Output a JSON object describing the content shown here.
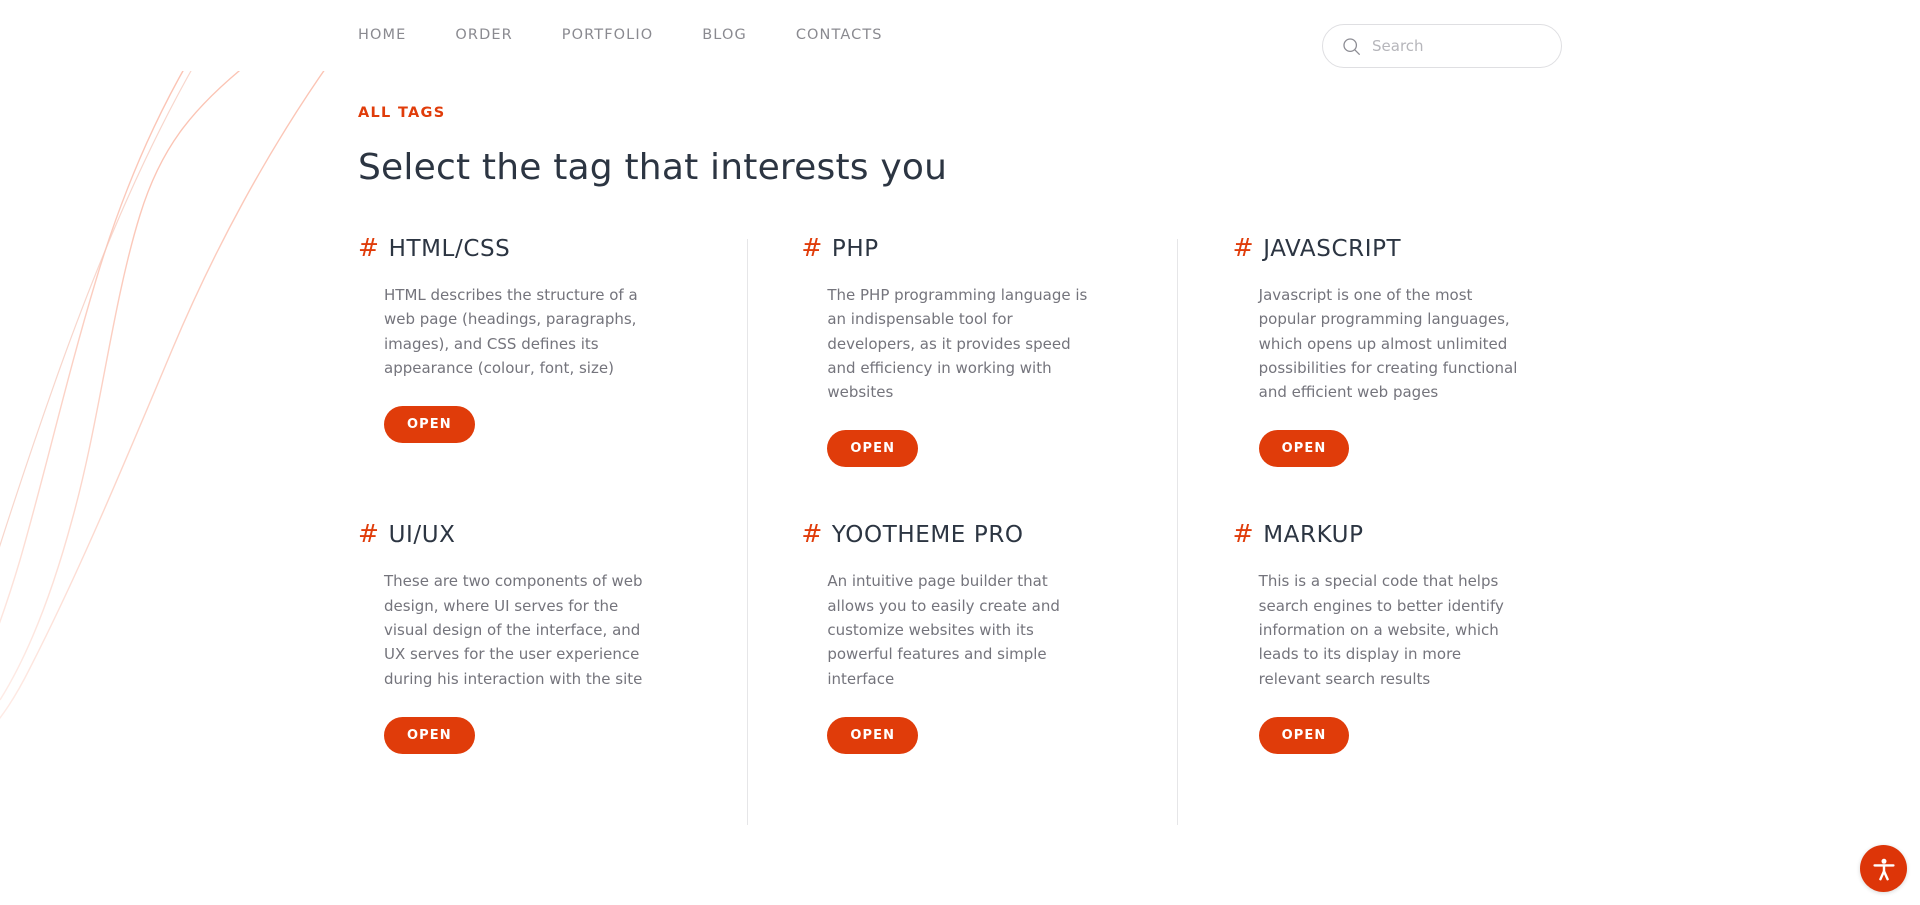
{
  "header": {
    "nav": [
      {
        "label": "HOME",
        "name": "nav-item-home"
      },
      {
        "label": "ORDER",
        "name": "nav-item-order"
      },
      {
        "label": "PORTFOLIO",
        "name": "nav-item-portfolio"
      },
      {
        "label": "BLOG",
        "name": "nav-item-blog"
      },
      {
        "label": "CONTACTS",
        "name": "nav-item-contacts"
      }
    ],
    "search": {
      "placeholder": "Search",
      "value": "",
      "icon": "search-icon"
    }
  },
  "main": {
    "eyebrow": "ALL TAGS",
    "title": "Select the tag that interests you",
    "hash_symbol": "#",
    "tags": [
      {
        "title": "HTML/CSS",
        "description": "HTML describes the structure of a web page (headings, paragraphs, images), and CSS defines its appearance (colour, font, size)",
        "button": "OPEN"
      },
      {
        "title": "PHP",
        "description": "The PHP programming language is an indispensable tool for developers, as it provides speed and efficiency in working with websites",
        "button": "OPEN"
      },
      {
        "title": "JAVASCRIPT",
        "description": "Javascript is one of the most popular programming languages, which opens up almost unlimited possibilities for creating functional and efficient web pages",
        "button": "OPEN"
      },
      {
        "title": "UI/UX",
        "description": "These are two components of web design, where UI serves for the visual design of the interface, and UX serves for the user experience during his interaction with the site",
        "button": "OPEN"
      },
      {
        "title": "YOOTHEME PRO",
        "description": "An intuitive page builder that allows you to easily create and customize websites with its powerful features and simple interface",
        "button": "OPEN"
      },
      {
        "title": "MARKUP",
        "description": "This is a special code that helps search engines to better identify information on a website, which leads to its display in more relevant search results",
        "button": "OPEN"
      }
    ]
  },
  "accessibility_widget": {
    "icon": "accessibility-person-icon"
  },
  "colors": {
    "accent": "#e03c0a",
    "heading": "#2c3542",
    "body_text": "#74747c",
    "nav_text": "#8a8a90",
    "divider": "#e6e6e8",
    "decor_line": "#f6c8bb"
  }
}
